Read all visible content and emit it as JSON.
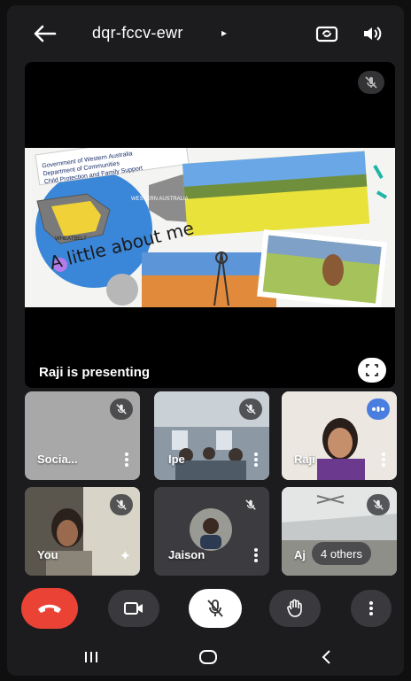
{
  "header": {
    "meeting_code": "dqr-fccv-ewr",
    "caret": "▸",
    "back_icon": "arrow-left-icon",
    "switch_camera_icon": "camera-switch-icon",
    "speaker_icon": "speaker-icon"
  },
  "presentation": {
    "presenter_label": "Raji is presenting",
    "slide": {
      "org_line1": "Government of Western Australia",
      "org_line2": "Department of Communities",
      "org_line3": "Child Protection and Family Support",
      "map_label": "WESTERN AUSTRALIA",
      "region_label": "WHEATBELT",
      "heading": "A little about me"
    }
  },
  "tiles": [
    {
      "name": "Socia...",
      "muted": true
    },
    {
      "name": "Ipe",
      "muted": true
    },
    {
      "name": "Raji",
      "muted": false
    },
    {
      "name": "You",
      "muted": true
    },
    {
      "name": "Jaison",
      "muted": true
    },
    {
      "name": "Aj",
      "others_label": "4 others",
      "muted": true
    }
  ],
  "colors": {
    "end_call": "#ea4335",
    "active_speaker": "#4a7de0"
  },
  "controls": {
    "end_icon": "phone-hangup-icon",
    "video_icon": "video-camera-icon",
    "mic_icon": "mic-off-icon",
    "hand_icon": "raise-hand-icon",
    "more_icon": "more-vertical-icon"
  },
  "system_nav": {
    "recent": "recent-apps-icon",
    "home": "home-icon",
    "back": "back-chevron-icon"
  }
}
